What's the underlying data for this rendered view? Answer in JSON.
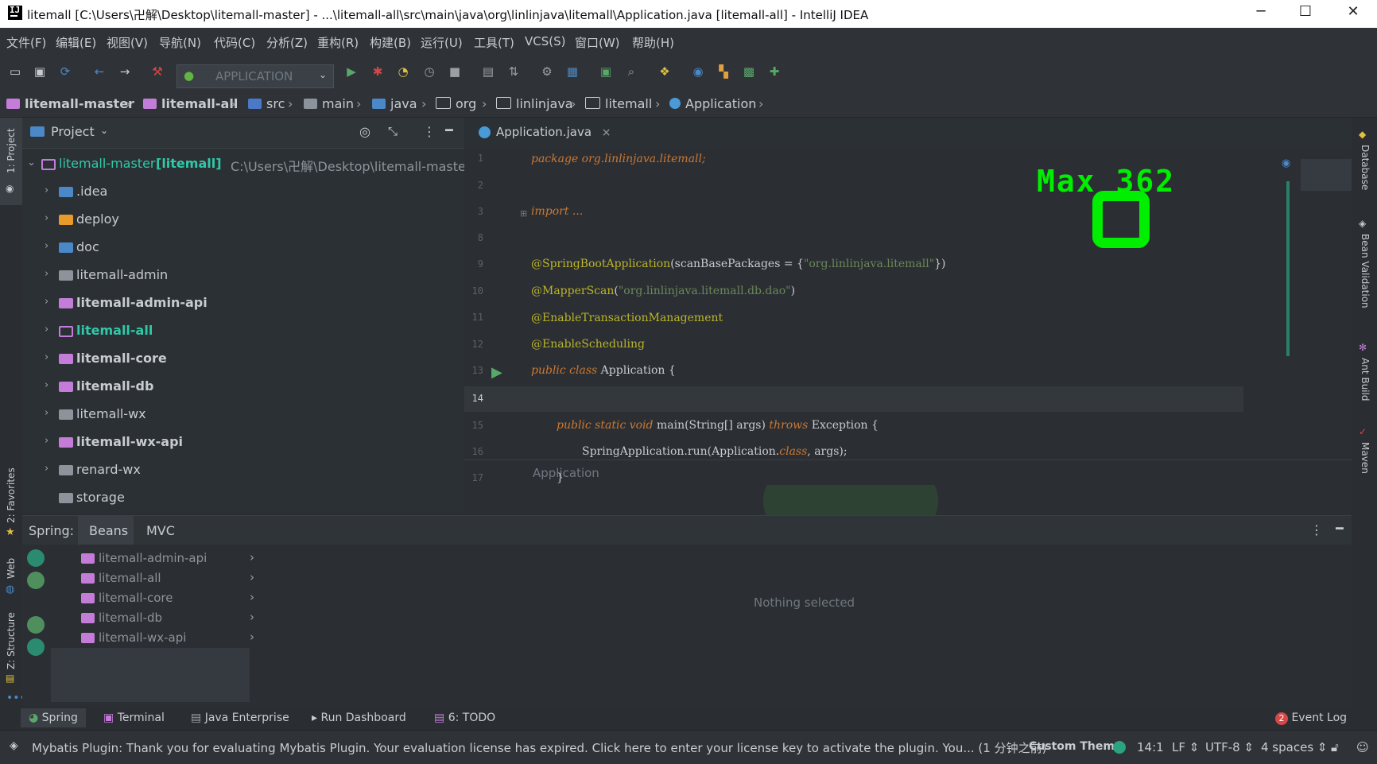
{
  "window": {
    "title": "litemall [C:\\Users\\卍解\\Desktop\\litemall-master] - ...\\litemall-all\\src\\main\\java\\org\\linlinjava\\litemall\\Application.java [litemall-all] - IntelliJ IDEA",
    "minimize": "─",
    "maximize": "☐",
    "close": "✕"
  },
  "menu": [
    "文件(F)",
    "编辑(E)",
    "视图(V)",
    "导航(N)",
    "代码(C)",
    "分析(Z)",
    "重构(R)",
    "构建(B)",
    "运行(U)",
    "工具(T)",
    "VCS(S)",
    "窗口(W)",
    "帮助(H)"
  ],
  "toolbar": {
    "run_config": "APPLICATION",
    "icons": [
      "folder-open-icon",
      "save-icon",
      "sync-icon",
      "back-icon",
      "forward-icon",
      "hammer-icon"
    ],
    "glyphs": [
      "▭",
      "💾",
      "⟳",
      "⇦",
      "⇨",
      "⚒"
    ]
  },
  "breadcrumb": [
    "litemall-master",
    "litemall-all",
    "src",
    "main",
    "java",
    "org",
    "linlinjava",
    "litemall",
    "Application"
  ],
  "left_strip": {
    "project": "1: Project",
    "favorites": "2: Favorites",
    "web": "Web",
    "structure": "Z: Structure"
  },
  "project_panel": {
    "title": "Project",
    "root": {
      "name": "litemall-master",
      "module": "[litemall]",
      "path": "C:\\Users\\卍解\\Desktop\\litemall-master"
    },
    "items": [
      {
        "name": ".idea",
        "bold": false
      },
      {
        "name": "deploy",
        "bold": false
      },
      {
        "name": "doc",
        "bold": false
      },
      {
        "name": "litemall-admin",
        "bold": false
      },
      {
        "name": "litemall-admin-api",
        "bold": true
      },
      {
        "name": "litemall-all",
        "bold": true
      },
      {
        "name": "litemall-core",
        "bold": true
      },
      {
        "name": "litemall-db",
        "bold": true
      },
      {
        "name": "litemall-wx",
        "bold": false
      },
      {
        "name": "litemall-wx-api",
        "bold": true
      },
      {
        "name": "renard-wx",
        "bold": false
      },
      {
        "name": "storage",
        "bold": false
      }
    ]
  },
  "editor": {
    "tab": "Application.java",
    "tab_close": "×",
    "line_numbers": [
      "1",
      "2",
      "3",
      "8",
      "9",
      "10",
      "11",
      "12",
      "13",
      "14",
      "15",
      "16",
      "17"
    ],
    "lines": {
      "l1": "package org.linlinjava.litemall;",
      "l3": "import ...",
      "l9a": "@SpringBootApplication",
      "l9b": "(scanBasePackages = {",
      "l9c": "\"org.linlinjava.litemall\"",
      "l9d": "})",
      "l10a": "@MapperScan",
      "l10b": "(",
      "l10c": "\"org.linlinjava.litemall.db.dao\"",
      "l10d": ")",
      "l11": "@EnableTransactionManagement",
      "l12": "@EnableScheduling",
      "l13a": "public class",
      "l13b": " Application {",
      "l15a": "public static void",
      "l15b": " main(String[] args) ",
      "l15c": "throws",
      "l15d": " Exception {",
      "l16a": "SpringApplication.run(Application.",
      "l16b": "class",
      "l16c": ", args);",
      "l17": "}"
    },
    "footer_crumb": "Application",
    "game_overlay": {
      "max_label": "Max 362",
      "score": "0"
    }
  },
  "right_strip": [
    "Database",
    "Bean Validation",
    "Ant Build",
    "Maven"
  ],
  "spring_panel": {
    "label": "Spring:",
    "tabs": [
      "Beans",
      "MVC"
    ],
    "active_tab": "Beans",
    "modules": [
      "litemall-admin-api",
      "litemall-all",
      "litemall-core",
      "litemall-db",
      "litemall-wx-api"
    ],
    "empty_text": "Nothing selected"
  },
  "bottom_tools": [
    {
      "label": "Spring",
      "icon": "spring-icon"
    },
    {
      "label": "Terminal",
      "icon": "terminal-icon"
    },
    {
      "label": "Java Enterprise",
      "icon": "java-enterprise-icon"
    },
    {
      "label": "Run Dashboard",
      "icon": "run-dashboard-icon"
    },
    {
      "label": "6: TODO",
      "icon": "todo-icon"
    }
  ],
  "event_log": {
    "label": "Event Log",
    "count": "2"
  },
  "status": {
    "message": "Mybatis Plugin: Thank you for evaluating Mybatis Plugin. Your evaluation license has expired.  Click here to enter your license key to activate the plugin. You... (1 分钟之前)",
    "theme": "Custom Theme",
    "position": "14:1",
    "line_sep": "LF ⇕",
    "encoding": "UTF-8 ⇕",
    "indent": "4 spaces ⇕"
  },
  "colors": {
    "accent": "#4a88c7",
    "game": "#00ee00",
    "module_folder": "#c37dd8",
    "text": "#c8ccd0"
  }
}
